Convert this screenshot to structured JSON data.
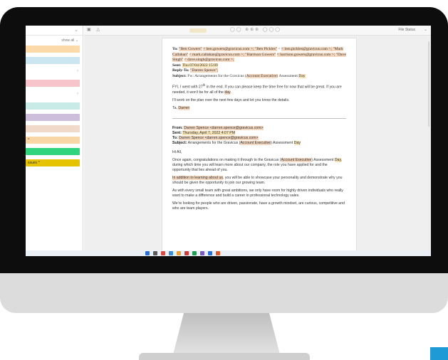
{
  "sidebar": {
    "show_all_label": "show all",
    "categories": [
      {
        "label": "",
        "color": "#fbd9a8"
      },
      {
        "label": "",
        "color": "#cbe6f0"
      },
      {
        "label": "",
        "color": "#f7c4cc"
      },
      {
        "label": "",
        "color": "#c9ebe8"
      },
      {
        "label": "",
        "color": "#cdbfdc"
      },
      {
        "label": "",
        "color": "#f0d9c9"
      },
      {
        "label": "^",
        "color": "#f8d6a6"
      },
      {
        "label": "",
        "color": "#2fd47c"
      },
      {
        "label": "ssues ^",
        "color": "#e6c300"
      }
    ]
  },
  "toolbar": {
    "file_status_label": "File Status"
  },
  "email": {
    "header1": {
      "to_label": "To:",
      "to_names": [
        "\"Ben Gowers\"",
        "\"Ben Pickles\"",
        "\"Mark Callahan\"",
        "\"Harrison Gowers\"",
        "\"Dave Singh\""
      ],
      "to_line1": "< ben.gowers@gravicus.com >; ",
      "to_line2": "< ben.pickles@gravicus.com >; ",
      "to_line3": "< mark.callahan@gravicus.com >; ",
      "to_line4": "< harrison.gowers@gravicus.com >; ",
      "to_line5": "< dave.singh@gravicus.com >;",
      "sent_label": "Sent:",
      "sent_value": "Thu 07/04/2022 15:09",
      "reply_label": "Reply-To:",
      "reply_value": "\"Darren Spence\";",
      "subject_label": "Subject:",
      "subject_prefix": "Fw: Arrangements for the Gravicus (",
      "subject_highlight": "Account Executive",
      "subject_suffix": ") Assessment ",
      "subject_day": "Day"
    },
    "body1": {
      "p1a": "FYI, I went with 27",
      "p1_sup": "th",
      "p1b": " in the end.  If you can please keep the time free for now that will be great.  If you are needed, it won't be for all of the ",
      "p1_day": "day",
      "p1c": ".",
      "p2": "I'll work on the plan over the next few days and let you know the details.",
      "sign_prefix": "Ta, ",
      "sign_name": "Darren"
    },
    "header2": {
      "from_label": "From:",
      "from_value": "Darren Spence <darren.spence@gravicus.com>",
      "sent_label": "Sent:",
      "sent_value": "Thursday, April 7, 2022 4:07 PM",
      "to_label": "To:",
      "to_value": "Darren Spence <darren.spence@gravicus.com>",
      "subject_label": "Subject:",
      "subject_prefix": "Arrangements for the Gravicus (",
      "subject_highlight": "Account Executive",
      "subject_suffix": ") Assessment ",
      "subject_day": "Day"
    },
    "body2": {
      "greeting": "Hi All,",
      "p1a": "Once again, congratulations on making it through to the Gravicus (",
      "p1_highlight": "Account Executive",
      "p1b": ") Assessment ",
      "p1_day": "Day",
      "p1c": ", during which time you will learn more about our company, the role you have applied for and the opportunity that lies ahead of you.",
      "p2_highlight": "In addition to learning about us",
      "p2b": ", you will be able to showcase your personality and demonstrate why you should be given the opportunity to join our growing team.",
      "p3": "As with every small team with great ambitions, we only have room for highly driven individuals who really want to make a difference and build a career in professional technology sales.",
      "p4": "We're looking for people who are driven, passionate, have a growth mindset, are curious, competitive and who are team players."
    }
  },
  "taskbar": {
    "icon_colors": [
      "#2a6fd6",
      "#5a5a5a",
      "#d94c3d",
      "#3a8fd9",
      "#e8a23c",
      "#d43a3a",
      "#1f9d55",
      "#7a5ac8",
      "#2a6fd6",
      "#e25a2a"
    ]
  }
}
